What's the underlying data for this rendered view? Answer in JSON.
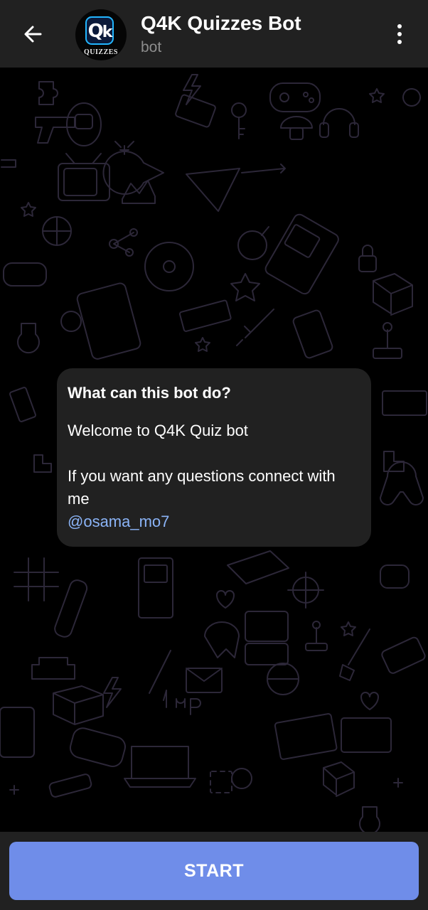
{
  "header": {
    "title": "Q4K Quizzes Bot",
    "subtitle": "bot",
    "back_icon": "arrow-left-icon",
    "menu_icon": "more-vertical-icon",
    "avatar": {
      "logo_text": "Q4K",
      "caption": "QUIZZES"
    }
  },
  "bot_info": {
    "heading": "What can this bot do?",
    "body": "Welcome to Q4K Quiz bot\n\nIf you want any questions connect with me",
    "link": "@osama_mo7"
  },
  "footer": {
    "start_label": "START"
  },
  "colors": {
    "header_bg": "#212121",
    "chat_bg": "#000000",
    "bubble_bg": "#212121",
    "link": "#8bb4f7",
    "start_button": "#6f8de9",
    "pattern_stroke": "#2a2536"
  }
}
